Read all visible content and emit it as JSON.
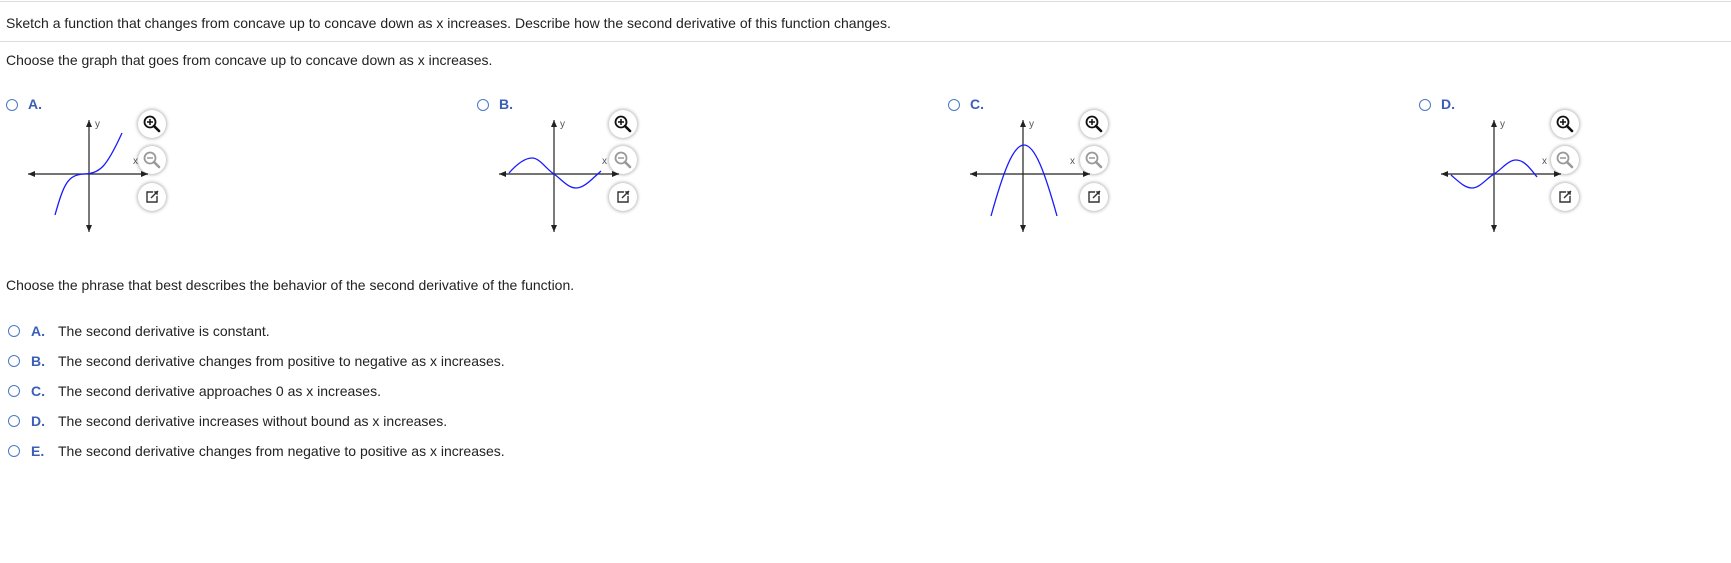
{
  "question": "Sketch a function that changes from concave up to concave down as x increases. Describe how the second derivative of this function changes.",
  "part1": {
    "prompt": "Choose the graph that goes from concave up to concave down as x increases.",
    "options": [
      {
        "letter": "A.",
        "x_label": "x",
        "y_label": "y"
      },
      {
        "letter": "B.",
        "x_label": "x",
        "y_label": "y"
      },
      {
        "letter": "C.",
        "x_label": "x",
        "y_label": "y"
      },
      {
        "letter": "D.",
        "x_label": "x",
        "y_label": "y"
      }
    ],
    "tool_icons": [
      "zoom-in-icon",
      "zoom-out-icon",
      "popout-icon"
    ]
  },
  "part2": {
    "prompt": "Choose the phrase that best describes the behavior of the second derivative of the function.",
    "options": [
      {
        "letter": "A.",
        "text": "The second derivative is constant."
      },
      {
        "letter": "B.",
        "text": "The second derivative changes from positive to negative as x increases."
      },
      {
        "letter": "C.",
        "text": "The second derivative approaches 0 as x increases."
      },
      {
        "letter": "D.",
        "text": "The second derivative increases without bound as x increases."
      },
      {
        "letter": "E.",
        "text": "The second derivative changes from negative to positive as x increases."
      }
    ]
  },
  "colors": {
    "accent": "#3b5fb5",
    "curve": "#1a1aff",
    "axis": "#222222"
  }
}
